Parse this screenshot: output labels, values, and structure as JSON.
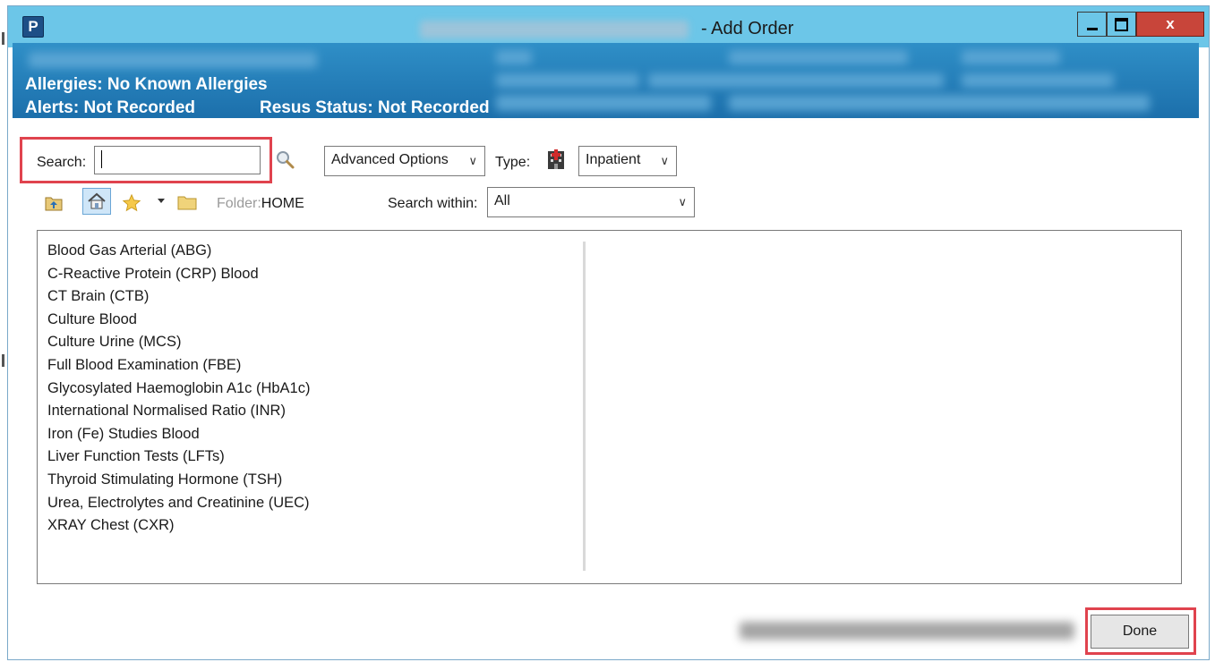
{
  "window": {
    "title_suffix": "- Add Order",
    "app_icon_letter": "P",
    "close_label": "x"
  },
  "banner": {
    "allergies": "Allergies: No Known Allergies",
    "alerts": "Alerts: Not Recorded",
    "resus_status": "Resus Status: Not Recorded"
  },
  "toolbar": {
    "search_label": "Search:",
    "search_value": "",
    "advanced_options": "Advanced Options",
    "type_label": "Type:",
    "type_value": "Inpatient",
    "folder_label": "Folder:",
    "folder_value": "HOME",
    "search_within_label": "Search within:",
    "search_within_value": "All"
  },
  "orders": [
    "Blood Gas Arterial (ABG)",
    "C-Reactive Protein (CRP) Blood",
    "CT Brain (CTB)",
    "Culture Blood",
    "Culture Urine (MCS)",
    "Full Blood Examination (FBE)",
    "Glycosylated Haemoglobin A1c (HbA1c)",
    "International Normalised Ratio (INR)",
    "Iron (Fe) Studies Blood",
    "Liver Function Tests (LFTs)",
    "Thyroid Stimulating Hormone (TSH)",
    "Urea, Electrolytes and Creatinine (UEC)",
    "XRAY Chest (CXR)"
  ],
  "footer": {
    "done_label": "Done"
  },
  "icons": {
    "search": "magnifier-icon",
    "type": "inpatient-building-icon",
    "up_folder": "up-folder-icon",
    "home": "home-icon",
    "favorites": "star-icon",
    "folder": "folder-icon"
  },
  "colors": {
    "titlebar": "#6cc6e8",
    "banner": "#1c6fab",
    "highlight": "#e0434e",
    "close_button": "#c8453a"
  }
}
